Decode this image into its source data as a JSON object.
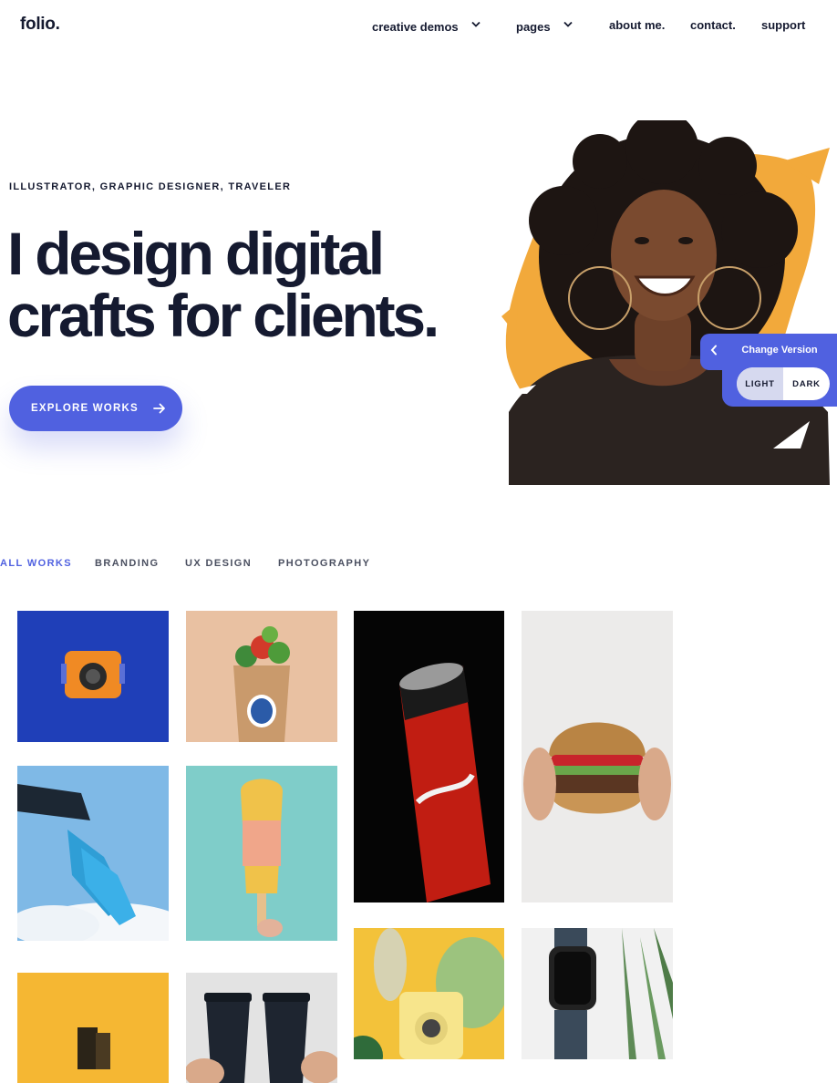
{
  "header": {
    "logo": "folio.",
    "nav": [
      {
        "label": "creative demos",
        "has_dropdown": true
      },
      {
        "label": "pages",
        "has_dropdown": true
      },
      {
        "label": "about me.",
        "has_dropdown": false
      },
      {
        "label": "contact.",
        "has_dropdown": false
      },
      {
        "label": "support",
        "has_dropdown": false
      }
    ]
  },
  "hero": {
    "subtitle": "ILLUSTRATOR, GRAPHIC DESIGNER, TRAVELER",
    "headline_line1": "I design digital",
    "headline_line2": "crafts for clients.",
    "cta_label": "EXPLORE WORKS"
  },
  "version_switcher": {
    "title": "Change Version",
    "options": [
      "LIGHT",
      "DARK"
    ],
    "selected": "LIGHT"
  },
  "filters": {
    "items": [
      "ALL WORKS",
      "BRANDING",
      "UX DESIGN",
      "PHOTOGRAPHY"
    ],
    "active": "ALL WORKS"
  },
  "portfolio": [
    {
      "subject": "orange camera on blue background"
    },
    {
      "subject": "grocery bag with vegetables"
    },
    {
      "subject": "coca-cola zero sugar can"
    },
    {
      "subject": "burger held in hands"
    },
    {
      "subject": "blue sneakers against sky"
    },
    {
      "subject": "popsicle on teal background"
    },
    {
      "subject": "film canister on yellow"
    },
    {
      "subject": "madcap coffee cups"
    },
    {
      "subject": "instant camera with leaves"
    },
    {
      "subject": "smart watch with plant"
    }
  ],
  "colors": {
    "accent": "#5061e0",
    "text": "#151a30",
    "portrait_splash": "#f2a93b"
  }
}
